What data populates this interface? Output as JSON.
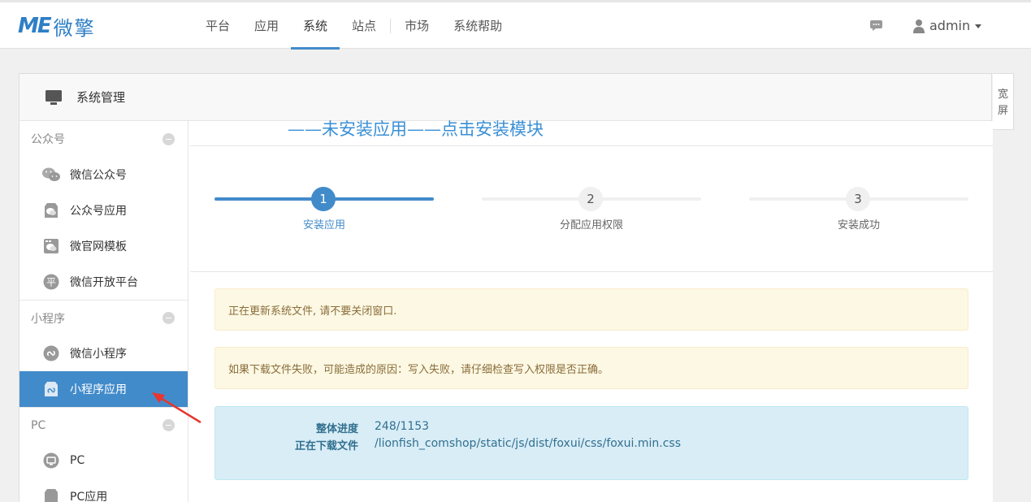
{
  "brand": {
    "mark": "ME",
    "name": "微擎"
  },
  "nav": {
    "items": [
      {
        "label": "平台"
      },
      {
        "label": "应用"
      },
      {
        "label": "系统"
      },
      {
        "label": "站点"
      },
      {
        "label": "市场"
      },
      {
        "label": "系统帮助"
      }
    ],
    "active": "系统"
  },
  "user": {
    "name": "admin"
  },
  "panel": {
    "title": "系统管理",
    "wide_toggle": "宽屏"
  },
  "sidebar": {
    "sections": [
      {
        "title": "公众号",
        "items": [
          {
            "label": "微信公众号",
            "icon": "wechat-icon"
          },
          {
            "label": "公众号应用",
            "icon": "wechat-app-icon"
          },
          {
            "label": "微官网模板",
            "icon": "microsite-template-icon"
          },
          {
            "label": "微信开放平台",
            "icon": "open-platform-icon"
          }
        ]
      },
      {
        "title": "小程序",
        "items": [
          {
            "label": "微信小程序",
            "icon": "miniprogram-icon"
          },
          {
            "label": "小程序应用",
            "icon": "miniprogram-app-icon",
            "active": true
          }
        ]
      },
      {
        "title": "PC",
        "items": [
          {
            "label": "PC",
            "icon": "pc-icon"
          },
          {
            "label": "PC应用",
            "icon": "pc-app-icon"
          }
        ]
      }
    ]
  },
  "annotation": "——未安装应用——点击安装模块",
  "steps": [
    {
      "num": "1",
      "label": "安装应用",
      "done": true
    },
    {
      "num": "2",
      "label": "分配应用权限",
      "done": false
    },
    {
      "num": "3",
      "label": "安装成功",
      "done": false
    }
  ],
  "alerts": [
    "正在更新系统文件, 请不要关闭窗口.",
    "如果下载文件失败，可能造成的原因：写入失败，请仔细检查写入权限是否正确。"
  ],
  "progress": {
    "overall_label": "整体进度",
    "overall_value": "248/1153",
    "downloading_label": "正在下载文件",
    "downloading_value": "/lionfish_comshop/static/js/dist/foxui/css/foxui.min.css"
  },
  "colors": {
    "accent": "#428bca",
    "brand": "#2e7fc5",
    "annotation": "#3a8fd6",
    "arrow": "#e8352e"
  }
}
